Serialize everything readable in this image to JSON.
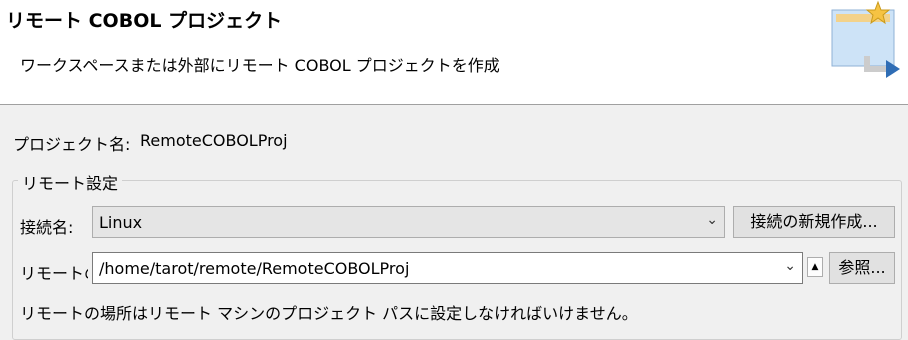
{
  "banner": {
    "title": "リモート COBOL プロジェクト",
    "description": "ワークスペースまたは外部にリモート COBOL プロジェクトを作成",
    "icon": "new-project-wizard-icon"
  },
  "project": {
    "name_label": "プロジェクト名:",
    "name_value": "RemoteCOBOLProj"
  },
  "remote_settings": {
    "group_label": "リモート設定",
    "connection_label": "接続名:",
    "connection_value": "Linux",
    "new_connection_button": "接続の新規作成...",
    "location_label": "リモートの",
    "location_value": "/home/tarot/remote/RemoteCOBOLProj",
    "browse_button": "参照...",
    "message": "リモートの場所はリモート マシンのプロジェクト パスに設定しなければいけません。"
  },
  "colors": {
    "banner_bg": "#ffffff",
    "dialog_bg": "#f0f0f0",
    "button_bg": "#e1e1e1",
    "border": "#7a7a7a"
  }
}
